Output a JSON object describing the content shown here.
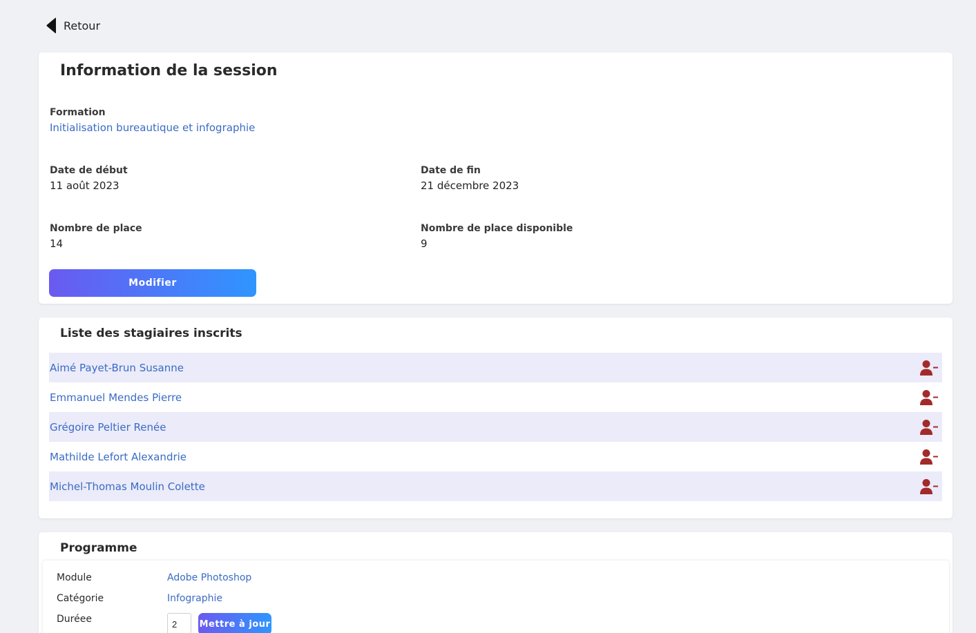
{
  "nav": {
    "back_label": "Retour"
  },
  "session": {
    "title": "Information de la session",
    "formation_label": "Formation",
    "formation_value": "Initialisation bureautique et infographie",
    "start_label": "Date de début",
    "start_value": "11 août 2023",
    "end_label": "Date de fin",
    "end_value": "21 décembre 2023",
    "seats_label": "Nombre de place",
    "seats_value": "14",
    "available_label": "Nombre de place disponible",
    "available_value": "9",
    "edit_label": "Modifier"
  },
  "trainees": {
    "title": "Liste des stagiaires inscrits",
    "items": [
      {
        "name": "Aimé Payet-Brun Susanne"
      },
      {
        "name": "Emmanuel Mendes Pierre"
      },
      {
        "name": "Grégoire Peltier Renée"
      },
      {
        "name": "Mathilde Lefort Alexandrie"
      },
      {
        "name": "Michel-Thomas Moulin Colette"
      }
    ],
    "remove_icon": "user-minus-icon"
  },
  "program": {
    "title": "Programme",
    "module_label": "Module",
    "module_value": "Adobe Photoshop",
    "category_label": "Catégorie",
    "category_value": "Infographie",
    "duration_label": "Duréee",
    "duration_value": "2",
    "update_label": "Mettre à jour"
  },
  "colors": {
    "accent_start": "#6a5af0",
    "accent_end": "#2f95ff",
    "link": "#3a6bc4",
    "remove_icon": "#a32a2a",
    "row_alt": "#ebebf9"
  }
}
